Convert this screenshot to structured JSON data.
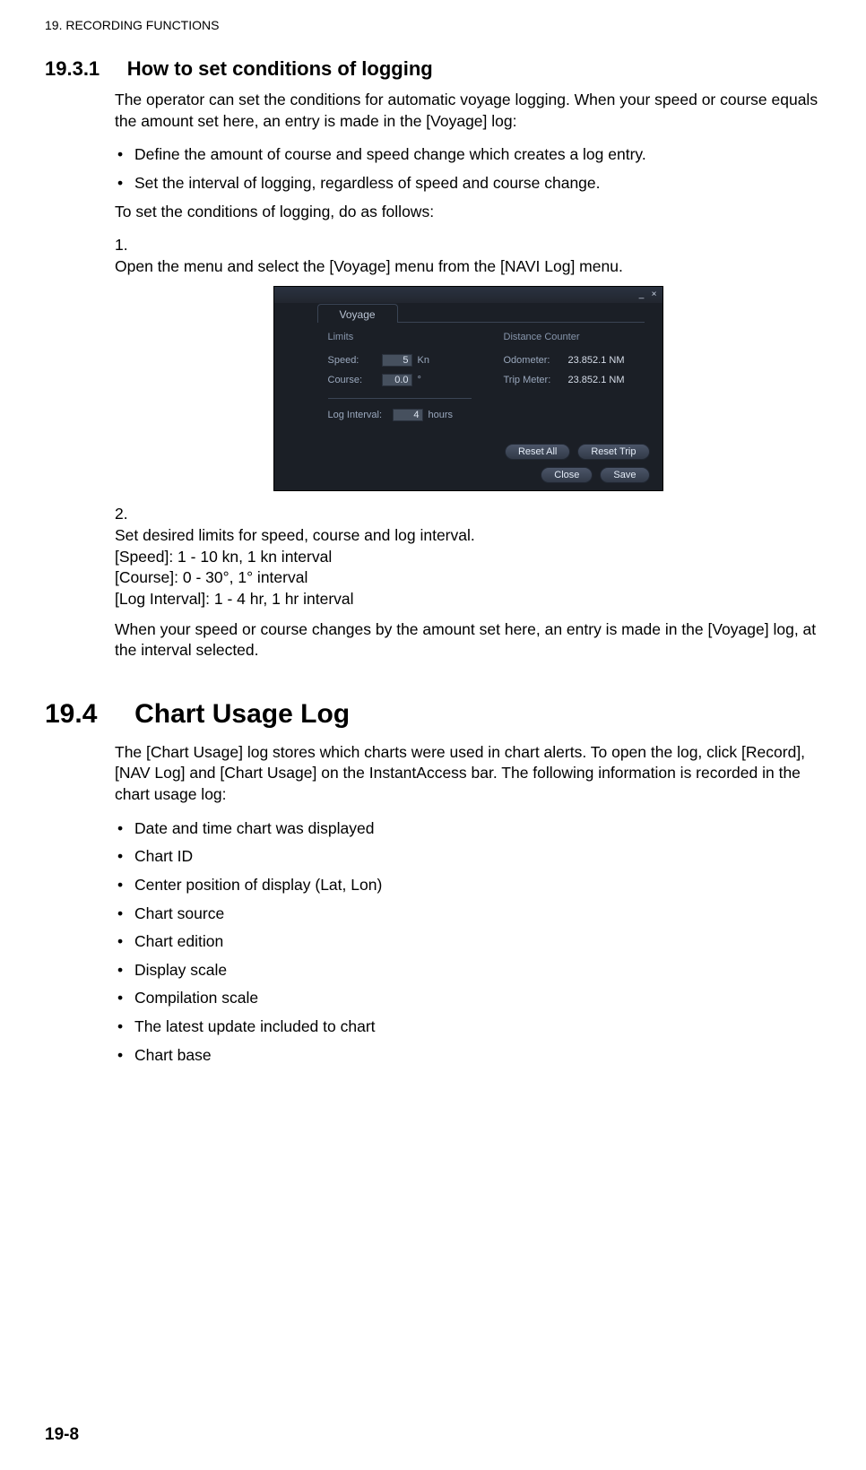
{
  "header": {
    "chapter": "19.  RECORDING FUNCTIONS"
  },
  "sec1931": {
    "num": "19.3.1",
    "title": "How to set conditions of logging",
    "p1": "The operator can set the conditions for automatic voyage logging. When your speed or course equals the amount set here, an entry is made in the [Voyage] log:",
    "b1": "Define the amount of course and speed change which creates a log entry.",
    "b2": "Set the interval of logging, regardless of speed and course change.",
    "p2": "To set the conditions of logging, do as follows:",
    "step1_num": "1.",
    "step1": "Open the menu and select the [Voyage] menu from the [NAVI Log] menu.",
    "step2_num": "2.",
    "step2": "Set desired limits for speed, course and log interval.",
    "spec1": "[Speed]: 1 - 10 kn, 1 kn interval",
    "spec2": "[Course]: 0 - 30°, 1° interval",
    "spec3": "[Log Interval]: 1 - 4 hr, 1 hr interval",
    "p3": "When your speed or course changes by the amount set here, an entry is made in the [Voyage] log, at the interval selected."
  },
  "dialog": {
    "tab": "Voyage",
    "limits_head": "Limits",
    "speed_label": "Speed:",
    "speed_value": "5",
    "speed_unit": "Kn",
    "course_label": "Course:",
    "course_value": "0.0",
    "course_unit": "°",
    "log_label": "Log Interval:",
    "log_value": "4",
    "log_unit": "hours",
    "dist_head": "Distance Counter",
    "odo_label": "Odometer:",
    "odo_value": "23.852.1 NM",
    "trip_label": "Trip Meter:",
    "trip_value": "23.852.1 NM",
    "btn_resetall": "Reset All",
    "btn_resettrip": "Reset Trip",
    "btn_close": "Close",
    "btn_save": "Save"
  },
  "sec194": {
    "num": "19.4",
    "title": "Chart Usage Log",
    "p1": "The [Chart Usage] log stores which charts were used in chart alerts. To open the log, click [Record], [NAV Log] and [Chart Usage] on the InstantAccess bar. The following information is recorded in the chart usage log:",
    "items": {
      "i1": "Date and time chart was displayed",
      "i2": "Chart ID",
      "i3": "Center position of display (Lat, Lon)",
      "i4": "Chart source",
      "i5": "Chart edition",
      "i6": "Display scale",
      "i7": "Compilation scale",
      "i8": "The latest update included to chart",
      "i9": "Chart base"
    }
  },
  "footer": {
    "page": "19-8"
  }
}
